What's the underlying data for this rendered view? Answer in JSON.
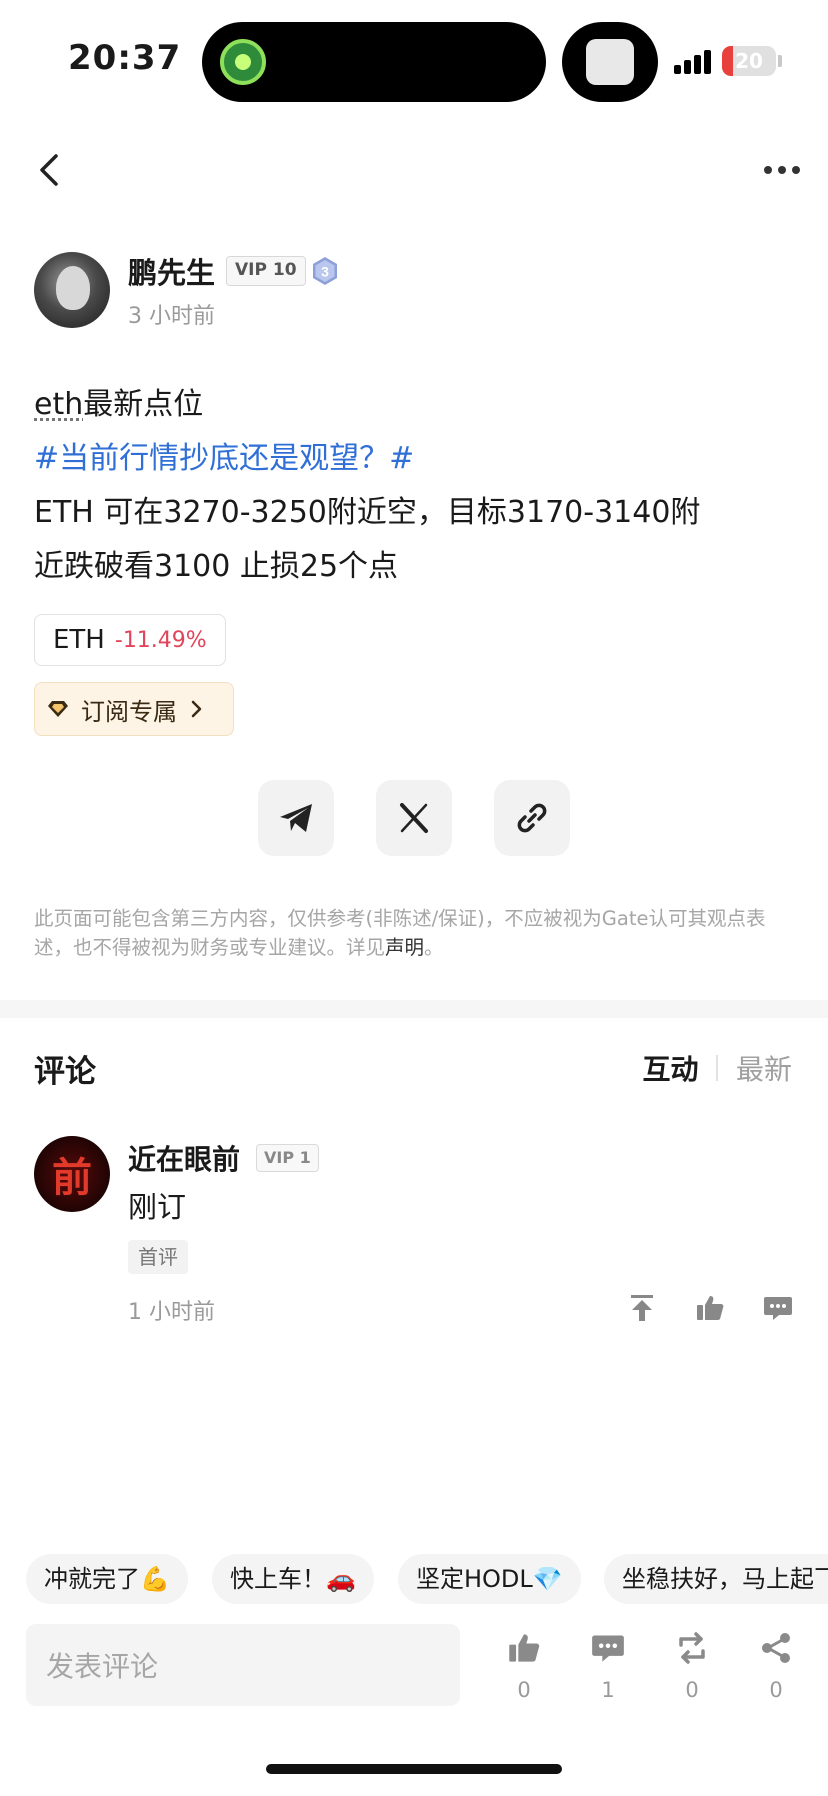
{
  "status_bar": {
    "time": "20:37",
    "battery": "20",
    "battery_level": 0.2
  },
  "nav": {
    "back_icon": "chevron-left-icon",
    "more_icon": "more-dots-icon"
  },
  "author": {
    "name": "鹏先生",
    "vip": "VIP 10",
    "level": "3",
    "posted": "3 小时前"
  },
  "post": {
    "title_link": "eth",
    "title_rest": "最新点位",
    "topic": "#当前行情抄底还是观望？#",
    "line1": "ETH 可在3270-3250附近空，目标3170-3140附",
    "line2": "近跌破看3100 止损25个点"
  },
  "ticker": {
    "symbol": "ETH",
    "change": "-11.49%"
  },
  "subscribe": {
    "label": "订阅专属",
    "icon": "diamond-icon"
  },
  "share": {
    "telegram_icon": "telegram-icon",
    "x_icon": "x-icon",
    "link_icon": "link-icon"
  },
  "disclaimer": {
    "text": "此页面可能包含第三方内容，仅供参考(非陈述/保证)，不应被视为Gate认可其观点表述，也不得被视为财务或专业建议。详见",
    "link": "声明",
    "end": "。"
  },
  "comments": {
    "title": "评论",
    "sort": {
      "active": "互动",
      "inactive": "最新"
    },
    "items": [
      {
        "avatar_char": "前",
        "name": "近在眼前",
        "vip": "VIP 1",
        "text": "刚订",
        "tag": "首评",
        "time": "1 小时前"
      }
    ]
  },
  "quick_replies": [
    "冲就完了💪",
    "快上车！🚗",
    "坚定HODL💎",
    "坐稳扶好，马上起飞"
  ],
  "bottom_bar": {
    "placeholder": "发表评论",
    "likes": "0",
    "comments": "1",
    "reposts": "0",
    "shares": "0"
  },
  "colors": {
    "topic": "#2f6fd6",
    "negative": "#e0455c",
    "battery": "#e8403c"
  }
}
